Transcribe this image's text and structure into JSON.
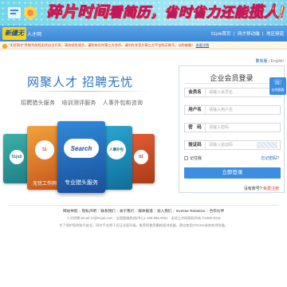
{
  "banner": {
    "slogan_part1": "碎片时间",
    "slogan_part2": "看简历，省时省力还能",
    "slogan_part3": "揽人!"
  },
  "header": {
    "logo_text": "新疆无忧",
    "logo_sub": "人才网",
    "links": [
      "51job首页",
      "网才移动端",
      "地区频道"
    ]
  },
  "notice": {
    "icon": "warning-icon",
    "text": "\"无忧网才\"系统为前程无忧自主开发，请勿轻信谣言，谨防有任何第三方合作。请勿在非官方第三方平台购买账号，以防被骗！",
    "more": "查看详情"
  },
  "language": {
    "zh": "繁体版",
    "en": "English"
  },
  "hero": {
    "title": "网聚人才 招聘无忧",
    "services": [
      "招聘猎头服务",
      "培训测评服务",
      "人事外包和咨询"
    ]
  },
  "carousel": {
    "cards": [
      {
        "caption": "",
        "emblem": "51job"
      },
      {
        "caption": "无忧工作网",
        "emblem": "51"
      },
      {
        "caption": "专业猎头服务",
        "emblem": "Search"
      },
      {
        "caption": "",
        "emblem": "人事外包"
      },
      {
        "caption": "",
        "emblem": "51"
      }
    ]
  },
  "login": {
    "title": "企业会员登录",
    "fields": [
      {
        "label": "会员名",
        "placeholder": "请输入会员名"
      },
      {
        "label": "用户名",
        "placeholder": "请输入用户名"
      },
      {
        "label": "密　码",
        "placeholder": "请输入密码"
      },
      {
        "label": "验证码",
        "placeholder": "请输入验证码"
      }
    ],
    "remember": "记住我",
    "forgot": "忘记密码?",
    "submit": "立即登录",
    "register_prefix": "没有账号?",
    "register_link": "免费注册"
  },
  "side_widget": {
    "icon": "chat-icon",
    "label": "在线客服"
  },
  "footer": {
    "links": [
      "网站导航",
      "隐私声明",
      "联系我们",
      "关于我们",
      "媒体报道",
      "加入我们",
      "Investor Relations",
      "合作伙伴"
    ],
    "info_line1": "人才招聘 Email: hr@51job.com　全国客服热线(中心): 400-886-0051　无忧工作网版权所有 ©1999-2018",
    "info_line2": "为了保护您的账号安全，网才平台将于近日全面升级。推荐您使用最新版浏览器，建议使用Chrome或其他浏览器。"
  }
}
